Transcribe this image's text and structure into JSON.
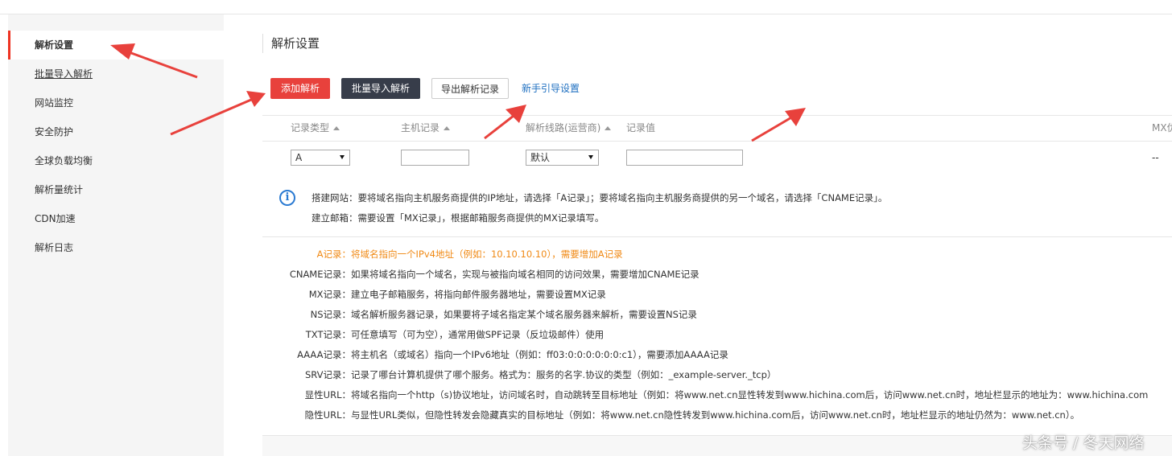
{
  "sidebar": {
    "items": [
      {
        "label": "解析设置"
      },
      {
        "label": "批量导入解析"
      },
      {
        "label": "网站监控"
      },
      {
        "label": "安全防护"
      },
      {
        "label": "全球负载均衡"
      },
      {
        "label": "解析量统计"
      },
      {
        "label": "CDN加速"
      },
      {
        "label": "解析日志"
      }
    ]
  },
  "main": {
    "title": "解析设置",
    "toolbar": {
      "add_label": "添加解析",
      "import_label": "批量导入解析",
      "export_label": "导出解析记录",
      "guide_label": "新手引导设置"
    },
    "table": {
      "headers": [
        "记录类型",
        "主机记录",
        "解析线路(运营商)",
        "记录值",
        "MX优"
      ],
      "row": {
        "record_type": "A",
        "line": "默认",
        "mx": "--"
      }
    },
    "tips": {
      "line1": "搭建网站：要将域名指向主机服务商提供的IP地址，请选择「A记录」；要将域名指向主机服务商提供的另一个域名，请选择「CNAME记录」。",
      "line2": "建立邮箱：需要设置「MX记录」，根据邮箱服务商提供的MX记录填写。"
    },
    "records": [
      {
        "label": "A记录：",
        "text": "将域名指向一个IPv4地址（例如：10.10.10.10），需要增加A记录"
      },
      {
        "label": "CNAME记录：",
        "text": "如果将域名指向一个域名，实现与被指向域名相同的访问效果，需要增加CNAME记录"
      },
      {
        "label": "MX记录：",
        "text": "建立电子邮箱服务，将指向邮件服务器地址，需要设置MX记录"
      },
      {
        "label": "NS记录：",
        "text": "域名解析服务器记录，如果要将子域名指定某个域名服务器来解析，需要设置NS记录"
      },
      {
        "label": "TXT记录：",
        "text": "可任意填写（可为空），通常用做SPF记录（反垃圾邮件）使用"
      },
      {
        "label": "AAAA记录：",
        "text": "将主机名（或域名）指向一个IPv6地址（例如：ff03:0:0:0:0:0:0:c1），需要添加AAAA记录"
      },
      {
        "label": "SRV记录：",
        "text": "记录了哪台计算机提供了哪个服务。格式为：服务的名字.协议的类型（例如：_example-server._tcp）"
      },
      {
        "label": "显性URL：",
        "text": "将域名指向一个http（s)协议地址，访问域名时，自动跳转至目标地址（例如：将www.net.cn显性转发到www.hichina.com后，访问www.net.cn时，地址栏显示的地址为：www.hichina.com"
      },
      {
        "label": "隐性URL：",
        "text": "与显性URL类似，但隐性转发会隐藏真实的目标地址（例如：将www.net.cn隐性转发到www.hichina.com后，访问www.net.cn时，地址栏显示的地址仍然为：www.net.cn）。"
      }
    ]
  },
  "watermark": "头条号 / 冬天网络",
  "colors": {
    "accent_red": "#e8413c",
    "dark_button": "#373d4a",
    "link_blue": "#1e6fc0",
    "highlight_orange": "#f08a16",
    "annotation_arrow": "#e8413c"
  },
  "icons": [
    "info-icon",
    "sort-asc-icon",
    "dropdown-caret-icon",
    "annotation-arrow"
  ]
}
